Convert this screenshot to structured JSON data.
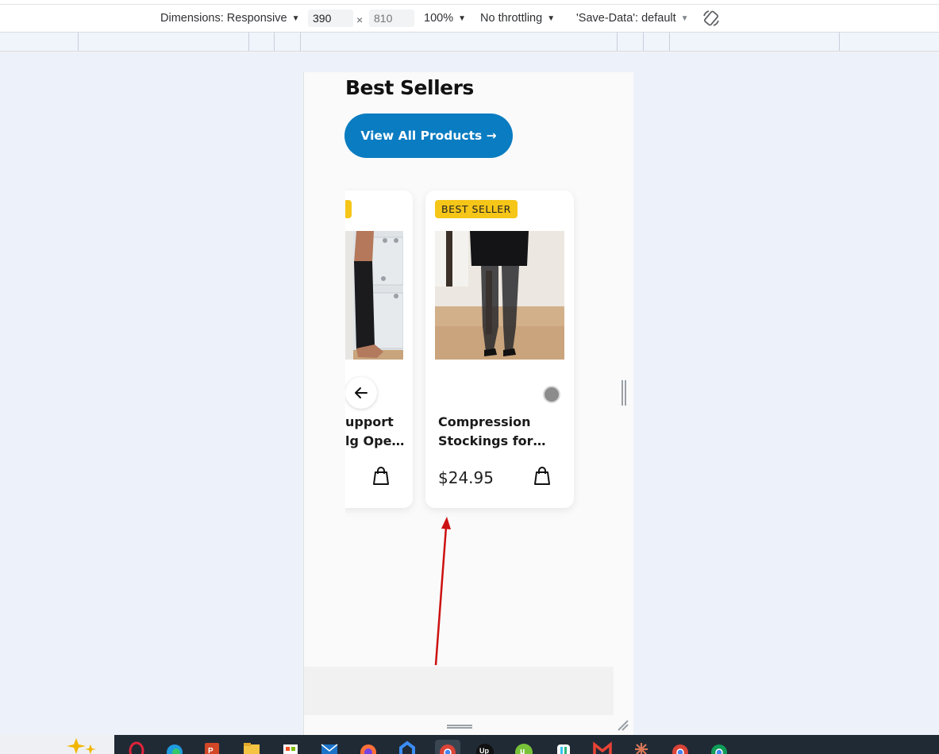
{
  "devtools": {
    "dimensions_label": "Dimensions: Responsive",
    "width_value": "390",
    "height_placeholder": "810",
    "zoom": "100%",
    "throttling": "No throttling",
    "save_data": "'Save-Data': default",
    "times": "×"
  },
  "page": {
    "title": "Best Sellers",
    "cta_label": "View All Products →"
  },
  "carousel": {
    "cards": [
      {
        "badge": "",
        "name_line1": "upport",
        "name_line2": "lg Ope…",
        "price": ""
      },
      {
        "badge": "BEST SELLER",
        "name_line1": "Compression",
        "name_line2": "Stockings for…",
        "price": "$24.95"
      }
    ]
  },
  "colors": {
    "cta": "#0a7cc1",
    "badge": "#f5c518",
    "annotation_arrow": "#cc1111"
  },
  "icons": [
    "rotate-icon",
    "arrow-left-icon",
    "shopping-bag-icon",
    "resize-grip-icon"
  ]
}
